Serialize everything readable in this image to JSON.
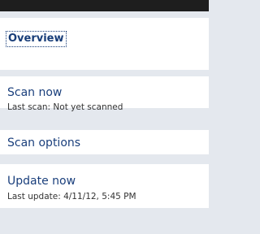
{
  "overview": {
    "label": "Overview"
  },
  "scan_now": {
    "label": "Scan now",
    "status": "Last scan: Not yet scanned"
  },
  "scan_options": {
    "label": "Scan options"
  },
  "update_now": {
    "label": "Update now",
    "status": "Last update: 4/11/12, 5:45 PM"
  },
  "colors": {
    "link": "#1a3f7c",
    "panel_bg": "#e4e8ee",
    "section_bg": "#ffffff",
    "top_bar": "#1e1e1e"
  }
}
